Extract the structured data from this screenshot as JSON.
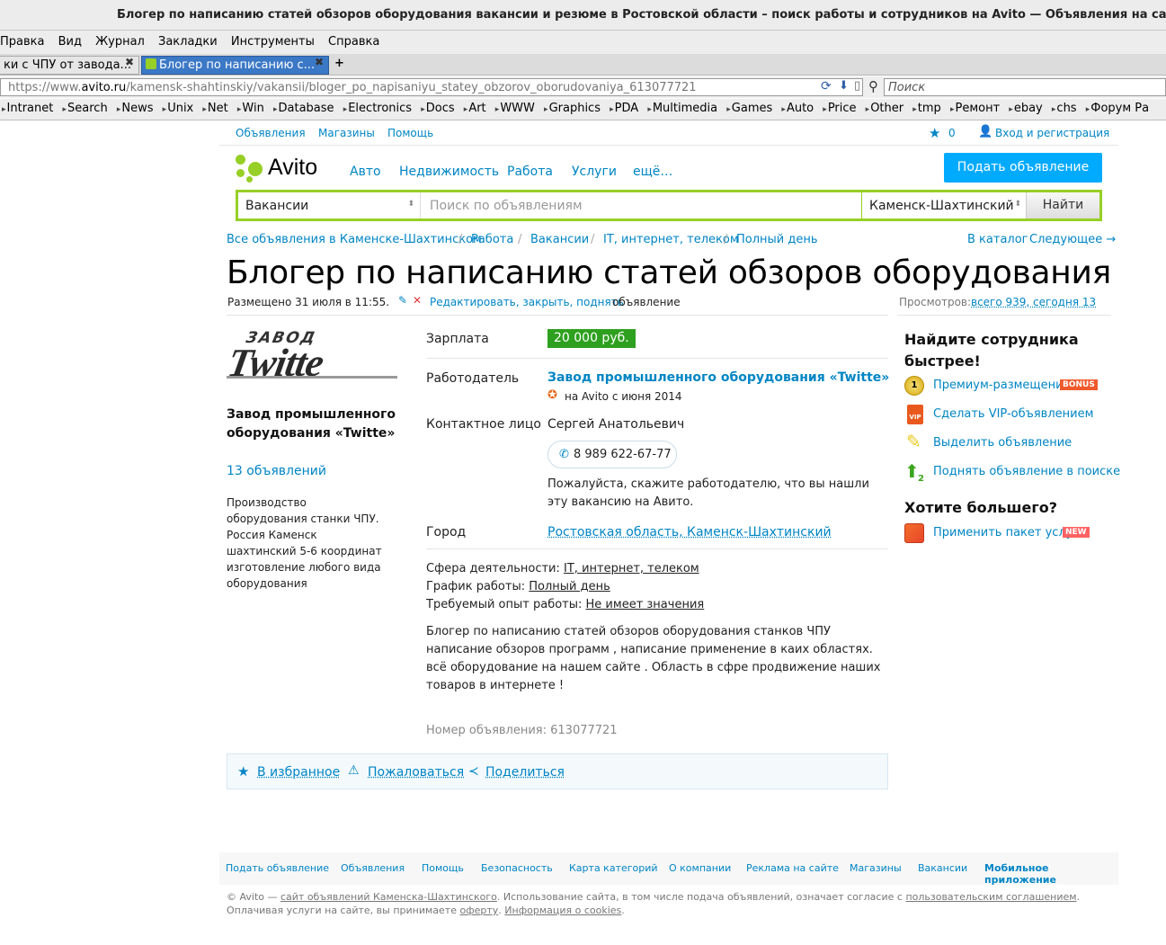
{
  "browser": {
    "title": "Блогер по написанию статей обзоров оборудования вакансии и резюме в Ростовской области – поиск работы и сотрудников на Avito — Объявления на сайте Avito — Mozill",
    "menu": [
      "Правка",
      "Вид",
      "Журнал",
      "Закладки",
      "Инструменты",
      "Справка"
    ],
    "tabs": [
      {
        "label": "ки с ЧПУ от завода..."
      },
      {
        "label": "Блогер по написанию с..."
      }
    ],
    "new_tab": "+",
    "url_prefix": "https://www.",
    "url_domain": "avito.ru",
    "url_path": "/kamensk-shahtinskiy/vakansii/bloger_po_napisaniyu_statey_obzorov_oborudovaniya_613077721",
    "search_placeholder": "Поиск",
    "bookmarks": [
      "Intranet",
      "Search",
      "News",
      "Unix",
      "Net",
      "Win",
      "Database",
      "Electronics",
      "Docs",
      "Art",
      "WWW",
      "Graphics",
      "PDA",
      "Multimedia",
      "Games",
      "Auto",
      "Price",
      "Other",
      "tmp",
      "Ремонт",
      "ebay",
      "chs",
      "Форум Ра"
    ]
  },
  "header": {
    "top_links": [
      "Объявления",
      "Магазины",
      "Помощь"
    ],
    "favorites_count": "0",
    "login": "Вход и регистрация",
    "logo": "Avito",
    "categories": [
      "Авто",
      "Недвижимость",
      "Работа",
      "Услуги",
      "ещё…"
    ],
    "post_button": "Подать объявление",
    "search": {
      "category": "Вакансии",
      "placeholder": "Поиск по объявлениям",
      "region": "Каменск-Шахтинский",
      "button": "Найти"
    }
  },
  "breadcrumbs": [
    "Все объявления в Каменске-Шахтинском",
    "Работа",
    "Вакансии",
    "IT, интернет, телеком",
    "Полный день"
  ],
  "nav": {
    "catalog": "В каталог",
    "next": "Следующее →"
  },
  "listing": {
    "title": "Блогер по написанию статей обзоров оборудования",
    "posted": "Размещено 31 июля в 11:55.",
    "edit_link": "Редактировать, закрыть, поднять",
    "edit_suffix": "объявление",
    "views_label": "Просмотров:",
    "views_link": "всего 939, сегодня 13",
    "salary_label": "Зарплата",
    "salary": "20 000 руб.",
    "employer_label": "Работодатель",
    "employer": "Завод промышленного оборудования «Twitte»",
    "on_avito": "на Avito с июня 2014",
    "contact_label": "Контактное лицо",
    "contact": "Сергей Анатольевич",
    "phone": "8 989 622-67-77",
    "mention": "Пожалуйста, скажите работодателю, что вы нашли эту вакансию на Авито.",
    "city_label": "Город",
    "city": "Ростовская область, Каменск-Шахтинский",
    "sphere_label": "Сфера деятельности:",
    "sphere": "IT, интернет, телеком",
    "schedule_label": "График работы:",
    "schedule": "Полный день",
    "experience_label": "Требуемый опыт работы:",
    "experience": "Не имеет значения",
    "description": "Блогер по написанию статей обзоров оборудования станков ЧПУ написание обзоров программ , написание применение в каих областях. всё оборудование на нашем сайте . Область в сфре продвижение наших товаров в интернете !",
    "number": "Номер объявления: 613077721",
    "actions": [
      "В избранное",
      "Пожаловаться",
      "Поделиться"
    ]
  },
  "seller": {
    "logo_top": "ЗАВОД",
    "logo_main": "Twitte",
    "name": "Завод промышленного оборудования «Twitte»",
    "count": "13 объявлений",
    "about": "Производство оборудования станки ЧПУ. Россия Каменск шахтинский 5-6 координат изготовление любого вида оборудования"
  },
  "sidebar": {
    "heading1": "Найдите сотрудника быстрее!",
    "items": [
      {
        "label": "Премиум-размещение",
        "badge": "BONUS"
      },
      {
        "label": "Сделать VIP-объявлением"
      },
      {
        "label": "Выделить объявление"
      },
      {
        "label": "Поднять объявление в поиске"
      }
    ],
    "heading2": "Хотите большего?",
    "package": {
      "label": "Применить пакет услуг",
      "badge": "NEW"
    }
  },
  "footer": {
    "links": [
      "Подать объявление",
      "Объявления",
      "Помощь",
      "Безопасность",
      "Карта категорий",
      "О компании",
      "Реклама на сайте",
      "Магазины",
      "Вакансии",
      "Мобильное приложение"
    ],
    "copyright": "© Avito —",
    "site_link": "сайт объявлений Каменска-Шахтинского",
    "terms1": ". Использование сайта, в том числе подача объявлений, означает согласие с",
    "agreement": "пользовательским соглашением",
    "line2a": "Оплачивая услуги на сайте, вы принимаете",
    "offer": "оферту",
    "cookies": "Информация о cookies"
  },
  "colors": {
    "link": "#0085c4",
    "green": "#97cf26",
    "post_button": "#00aaff",
    "salary_bg": "#2ea01f"
  }
}
